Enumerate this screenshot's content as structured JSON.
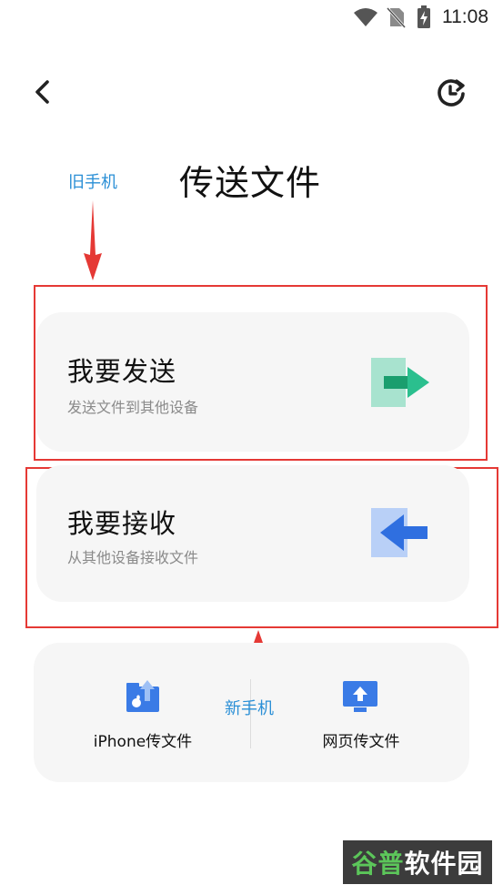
{
  "status_bar": {
    "time": "11:08"
  },
  "header": {
    "title": "传送文件"
  },
  "annotations": {
    "old_phone": "旧手机",
    "new_phone": "新手机"
  },
  "send_card": {
    "title": "我要发送",
    "subtitle": "发送文件到其他设备"
  },
  "receive_card": {
    "title": "我要接收",
    "subtitle": "从其他设备接收文件"
  },
  "bottom": {
    "iphone_label": "iPhone传文件",
    "web_label": "网页传文件"
  },
  "watermark": {
    "part1": "谷普",
    "part2": "软件园"
  },
  "colors": {
    "send_accent": "#2bbf8e",
    "receive_accent": "#2f6fe0",
    "annotation": "#e53935",
    "annotation_text": "#2a8fd6"
  },
  "icons": {
    "wifi": "wifi-icon",
    "no_sim": "no-sim-icon",
    "battery": "battery-charging-icon",
    "back": "chevron-left-icon",
    "history": "history-icon",
    "send": "send-arrow-icon",
    "receive": "receive-arrow-icon",
    "iphone": "iphone-upload-icon",
    "web": "monitor-upload-icon"
  }
}
